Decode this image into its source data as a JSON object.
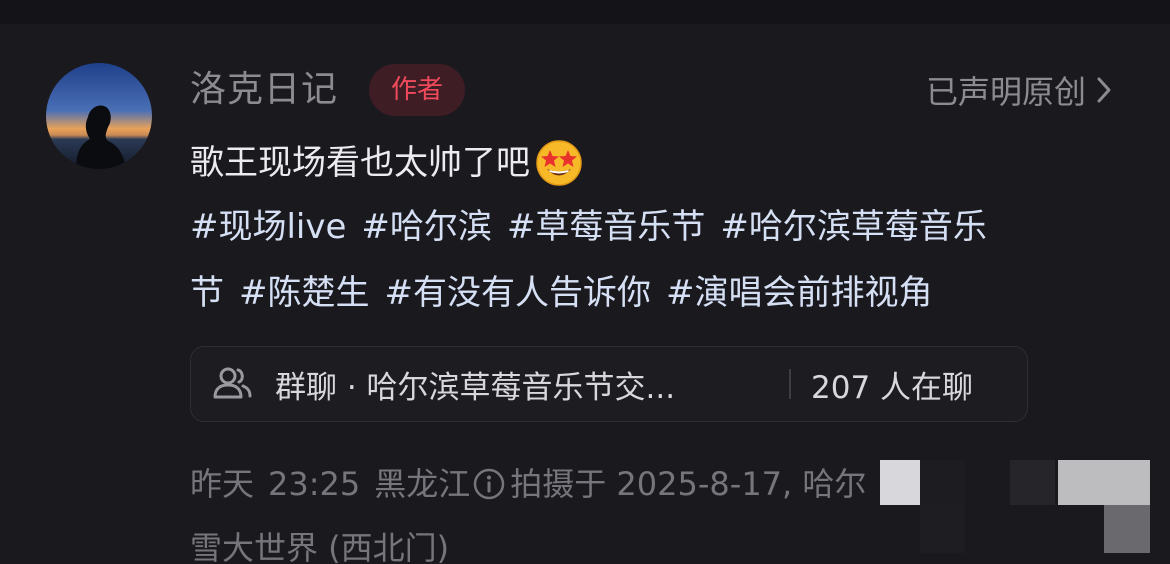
{
  "author": {
    "name": "洛克日记",
    "badge": "作者",
    "declared": "已声明原创"
  },
  "post": {
    "text": "歌王现场看也太帅了吧",
    "emoji": "star-struck-emoji",
    "tags_line1": [
      "#现场live",
      "#哈尔滨",
      "#草莓音乐节",
      "#哈尔滨草莓音乐"
    ],
    "tags_line2": [
      "节",
      "#陈楚生",
      "#有没有人告诉你",
      "#演唱会前排视角"
    ]
  },
  "group_chat": {
    "title": "群聊 · 哈尔滨草莓音乐节交...",
    "count": "207 人在聊"
  },
  "meta": {
    "date": "昨天",
    "time": "23:25",
    "location": "黑龙江",
    "shot_prefix": "拍摄于 2025-8-17, 哈尔",
    "place_line2": "雪大世界 (西北门)"
  },
  "colors": {
    "background": "#1a191e",
    "badge_text": "#f04a5c",
    "badge_bg": "#3e1d24",
    "tag_text": "#d6e0f5",
    "muted": "#76757b"
  },
  "icons": [
    "chevron-right-icon",
    "group-chat-icon",
    "info-icon",
    "star-struck-emoji"
  ]
}
